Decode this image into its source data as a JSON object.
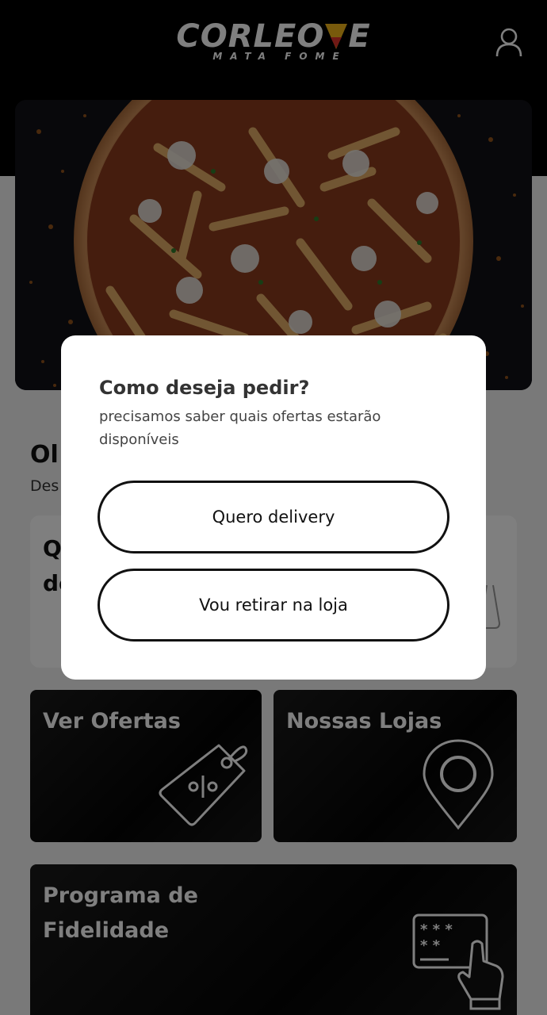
{
  "header": {
    "logo_text_left": "CORLEO",
    "logo_text_right": "E",
    "logo_tagline": "MATA FOME",
    "user_icon": "user-icon"
  },
  "hero": {
    "image": "pizza-with-fries-photo"
  },
  "greeting": {
    "title": "Ol",
    "subtitle": "Des"
  },
  "info_card": {
    "line1": "Q",
    "line2": "de",
    "icon": "cup-icon"
  },
  "tiles": {
    "offers": {
      "title": "Ver Ofertas",
      "icon": "price-tag-percent-icon"
    },
    "stores": {
      "title": "Nossas Lojas",
      "icon": "location-pin-icon"
    },
    "loyalty": {
      "title_line1": "Programa de",
      "title_line2": "Fidelidade",
      "icon": "loyalty-card-icon"
    }
  },
  "modal": {
    "title": "Como deseja pedir?",
    "subtitle": "precisamos saber quais ofertas estarão disponíveis",
    "delivery_label": "Quero delivery",
    "pickup_label": "Vou retirar na loja"
  },
  "colors": {
    "header_bg": "#000000",
    "logo_yellow": "#f1b418",
    "logo_red": "#e0322a",
    "overlay": "rgba(0,0,0,0.5)"
  }
}
